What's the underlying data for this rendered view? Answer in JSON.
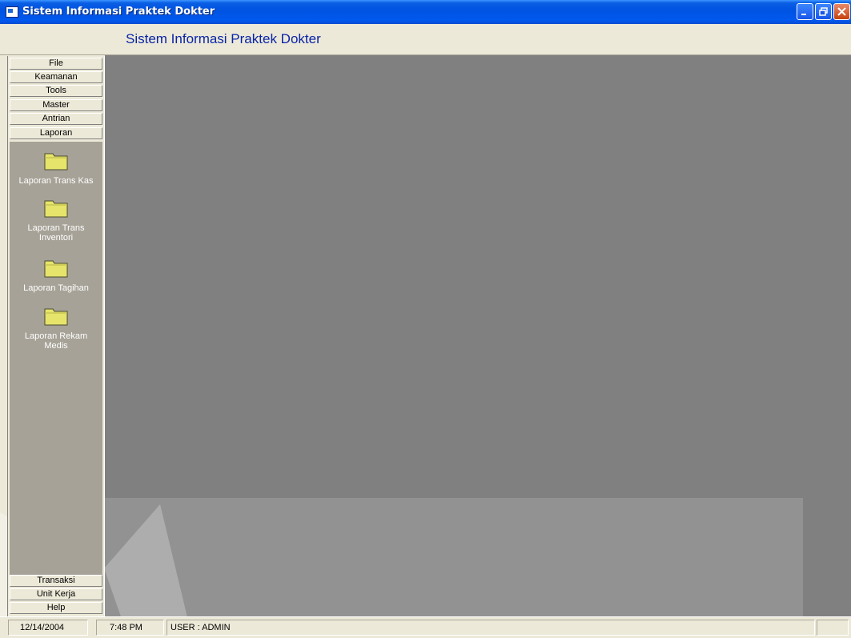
{
  "window": {
    "title": "Sistem Informasi Praktek Dokter",
    "controls": {
      "minimize": "minimize",
      "restore": "restore",
      "close": "close"
    }
  },
  "header": {
    "title": "Sistem Informasi Praktek Dokter"
  },
  "sidebar": {
    "top_groups": [
      {
        "label": "File"
      },
      {
        "label": "Keamanan"
      },
      {
        "label": "Tools"
      },
      {
        "label": "Master"
      },
      {
        "label": "Antrian"
      },
      {
        "label": "Laporan"
      }
    ],
    "active_group": "Laporan",
    "items": [
      {
        "label": "Laporan Trans Kas",
        "icon": "folder-icon"
      },
      {
        "label": "Laporan Trans Inventori",
        "icon": "folder-icon"
      },
      {
        "label": "Laporan Tagihan",
        "icon": "folder-icon"
      },
      {
        "label": "Laporan Rekam Medis",
        "icon": "folder-icon"
      }
    ],
    "bottom_groups": [
      {
        "label": "Transaksi"
      },
      {
        "label": "Unit Kerja"
      },
      {
        "label": "Help"
      }
    ]
  },
  "status": {
    "date": "12/14/2004",
    "time": "7:48 PM",
    "user": "USER : ADMIN"
  },
  "colors": {
    "title_bar": "#0058ee",
    "header_title": "#0a24a8",
    "main_background": "#808080",
    "nav_pane": "#a6a297",
    "folder": "#e6e46a"
  }
}
